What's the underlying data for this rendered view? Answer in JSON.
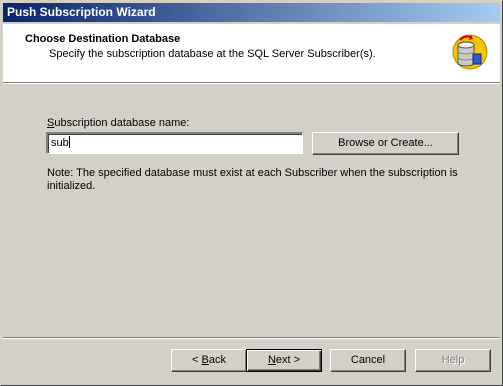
{
  "window": {
    "title": "Push Subscription Wizard"
  },
  "header": {
    "title": "Choose Destination Database",
    "subtitle": "Specify the subscription database at the SQL Server Subscriber(s)."
  },
  "form": {
    "db_label_mnemonic": "S",
    "db_label_rest": "ubscription database name:",
    "db_value": "sub",
    "browse_label": "Browse or Create...",
    "note": "Note: The specified database must exist at each Subscriber when the subscription is initialized."
  },
  "footer": {
    "back_arrow": "<",
    "back_mnemonic": "B",
    "back_rest": "ack",
    "next_mnemonic": "N",
    "next_rest": "ext >",
    "cancel_label": "Cancel",
    "help_label": "Help"
  }
}
